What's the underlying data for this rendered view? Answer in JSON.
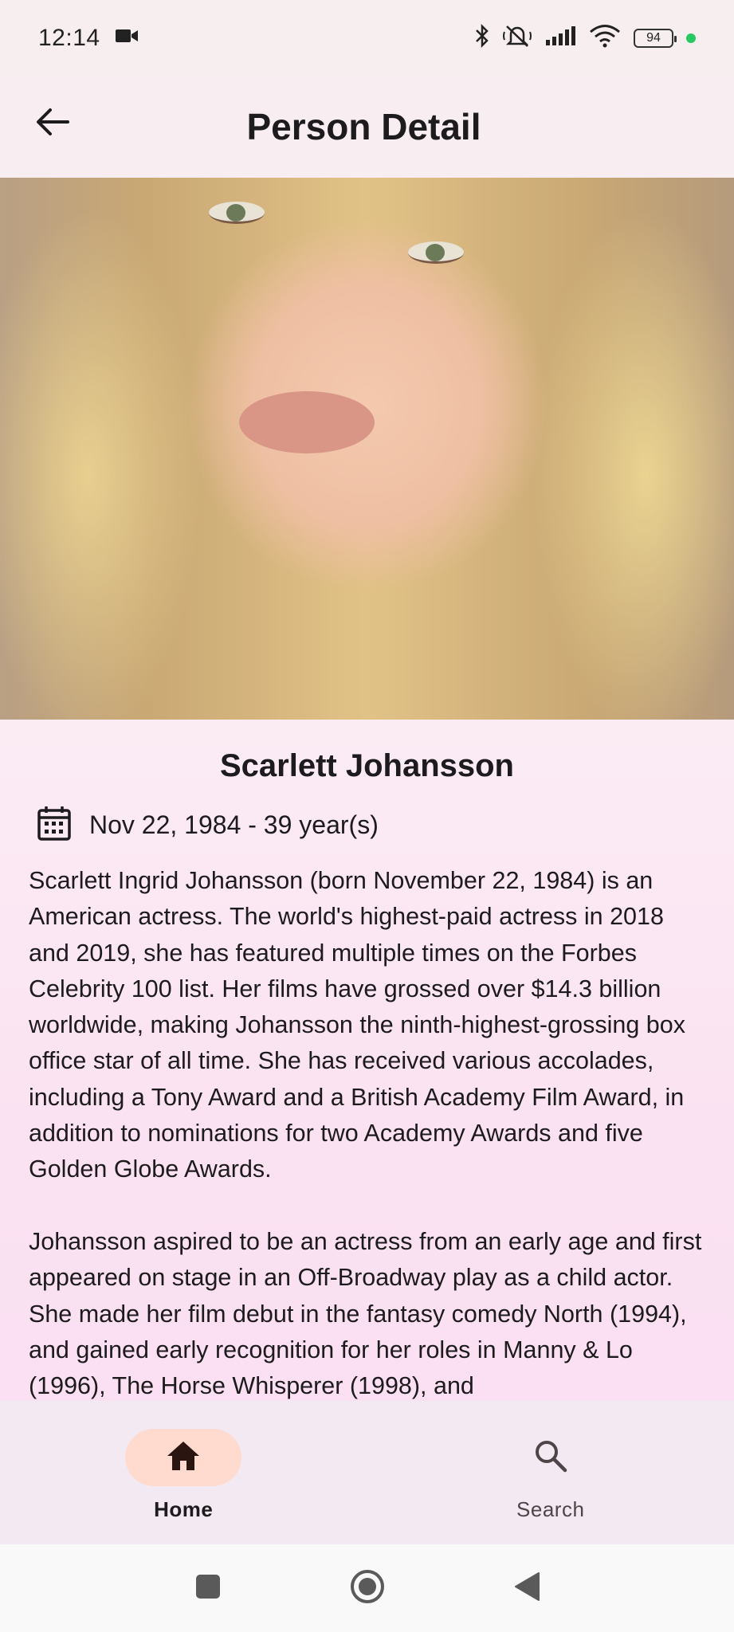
{
  "status_bar": {
    "time": "12:14",
    "battery": "94",
    "icons": [
      "video-camera-icon",
      "bluetooth-icon",
      "mute-icon",
      "signal-icon",
      "wifi-icon",
      "battery-icon"
    ],
    "dot_color": "#26c964"
  },
  "app_bar": {
    "title": "Person Detail",
    "back_icon": "arrow-left-icon"
  },
  "person": {
    "name": "Scarlett Johansson",
    "birth": "Nov 22, 1984 - 39 year(s)",
    "calendar_icon": "calendar-icon",
    "bio": "Scarlett Ingrid Johansson (born November 22, 1984) is an American actress. The world's highest-paid actress in 2018 and 2019, she has featured multiple times on the Forbes Celebrity 100 list. Her films have grossed over $14.3 billion worldwide, making Johansson the ninth-highest-grossing box office star of all time. She has received various accolades, including a Tony Award and a British Academy Film Award, in addition to nominations for two Academy Awards and five Golden Globe Awards.\n\nJohansson aspired to be an actress from an early age and first appeared on stage in an Off-Broadway play as a child actor. She made her film debut in the fantasy comedy North (1994), and gained early recognition for her roles in Manny & Lo (1996), The Horse Whisperer (1998), and"
  },
  "bottom_nav": {
    "items": [
      {
        "label": "Home",
        "icon": "home-icon",
        "active": true
      },
      {
        "label": "Search",
        "icon": "search-icon",
        "active": false
      }
    ],
    "active_color": "#ffdbcf"
  },
  "system_nav": {
    "buttons": [
      "recents-square-icon",
      "home-circle-icon",
      "back-triangle-icon"
    ]
  }
}
